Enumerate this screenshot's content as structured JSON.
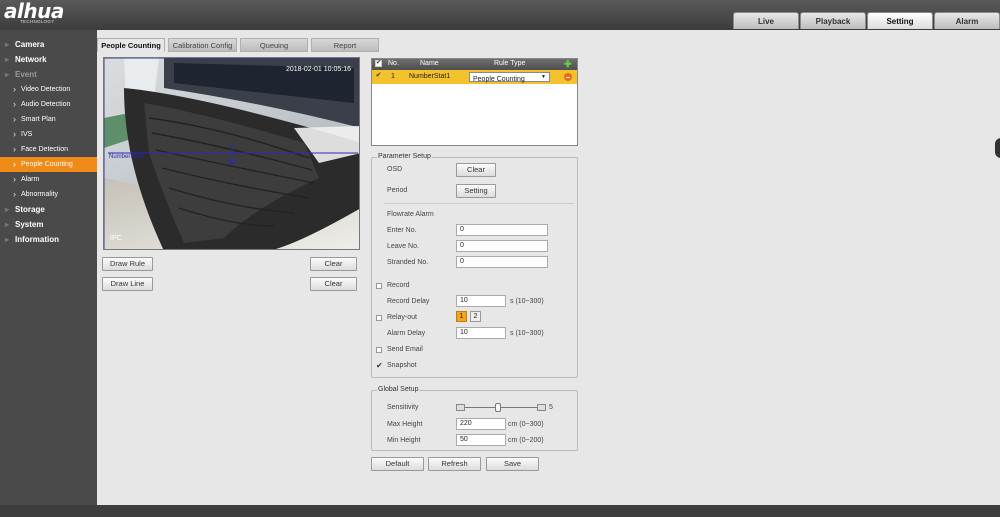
{
  "brand": {
    "logo": "alhua",
    "tagline": "TECHNOLOGY"
  },
  "top_tabs": [
    {
      "label": "Live",
      "active": false
    },
    {
      "label": "Playback",
      "active": false
    },
    {
      "label": "Setting",
      "active": true
    },
    {
      "label": "Alarm",
      "active": false
    }
  ],
  "sidebar": {
    "camera": "Camera",
    "network": "Network",
    "event": "Event",
    "event_items": [
      "Video Detection",
      "Audio Detection",
      "Smart Plan",
      "IVS",
      "Face Detection",
      "People Counting",
      "Alarm",
      "Abnormality"
    ],
    "selected": "People Counting",
    "storage": "Storage",
    "system": "System",
    "information": "Information"
  },
  "sub_tabs": [
    {
      "label": "People Counting",
      "active": true
    },
    {
      "label": "Calibration Config",
      "active": false
    },
    {
      "label": "Queuing",
      "active": false
    },
    {
      "label": "Report",
      "active": false
    }
  ],
  "video": {
    "timestamp": "2018-02-01 10:05:16",
    "rule_label": "NumberStat1",
    "channel_label": "IPC"
  },
  "video_buttons": {
    "draw_rule": "Draw Rule",
    "clear_rule": "Clear",
    "draw_line": "Draw Line",
    "clear_line": "Clear"
  },
  "rule_table": {
    "headers": {
      "no": "No.",
      "name": "Name",
      "rule_type": "Rule Type"
    },
    "rows": [
      {
        "no": "1",
        "name": "NumberStat1",
        "rule_type": "People Counting",
        "checked": true
      }
    ]
  },
  "parameter_setup": {
    "legend": "Parameter Setup",
    "osd_label": "OSD",
    "osd_button": "Clear",
    "period_label": "Period",
    "period_button": "Setting",
    "flowrate_alarm": "Flowrate Alarm",
    "enter_no_label": "Enter No.",
    "enter_no": "0",
    "leave_no_label": "Leave No.",
    "leave_no": "0",
    "stranded_no_label": "Stranded No.",
    "stranded_no": "0",
    "record_label": "Record",
    "record_checked": false,
    "record_delay_label": "Record Delay",
    "record_delay": "10",
    "record_delay_hint": "s (10~300)",
    "relay_out_label": "Relay-out",
    "relay_out_checked": false,
    "relay_channels": [
      {
        "label": "1",
        "active": true
      },
      {
        "label": "2",
        "active": false
      }
    ],
    "alarm_delay_label": "Alarm Delay",
    "alarm_delay": "10",
    "alarm_delay_hint": "s (10~300)",
    "send_email_label": "Send Email",
    "send_email_checked": false,
    "snapshot_label": "Snapshot",
    "snapshot_checked": true
  },
  "global_setup": {
    "legend": "Global Setup",
    "sensitivity_label": "Sensitivity",
    "sensitivity_value": "5",
    "sensitivity_fraction": 0.5,
    "max_height_label": "Max Height",
    "max_height": "220",
    "max_height_hint": "cm (0~300)",
    "min_height_label": "Min Height",
    "min_height": "50",
    "min_height_hint": "cm (0~200)"
  },
  "actions": {
    "default": "Default",
    "refresh": "Refresh",
    "save": "Save"
  },
  "colors": {
    "accent": "#f08a18",
    "selected_row": "#f3c22c",
    "sidebar": "#4a4a4a",
    "content_bg": "#e7e7e7"
  }
}
